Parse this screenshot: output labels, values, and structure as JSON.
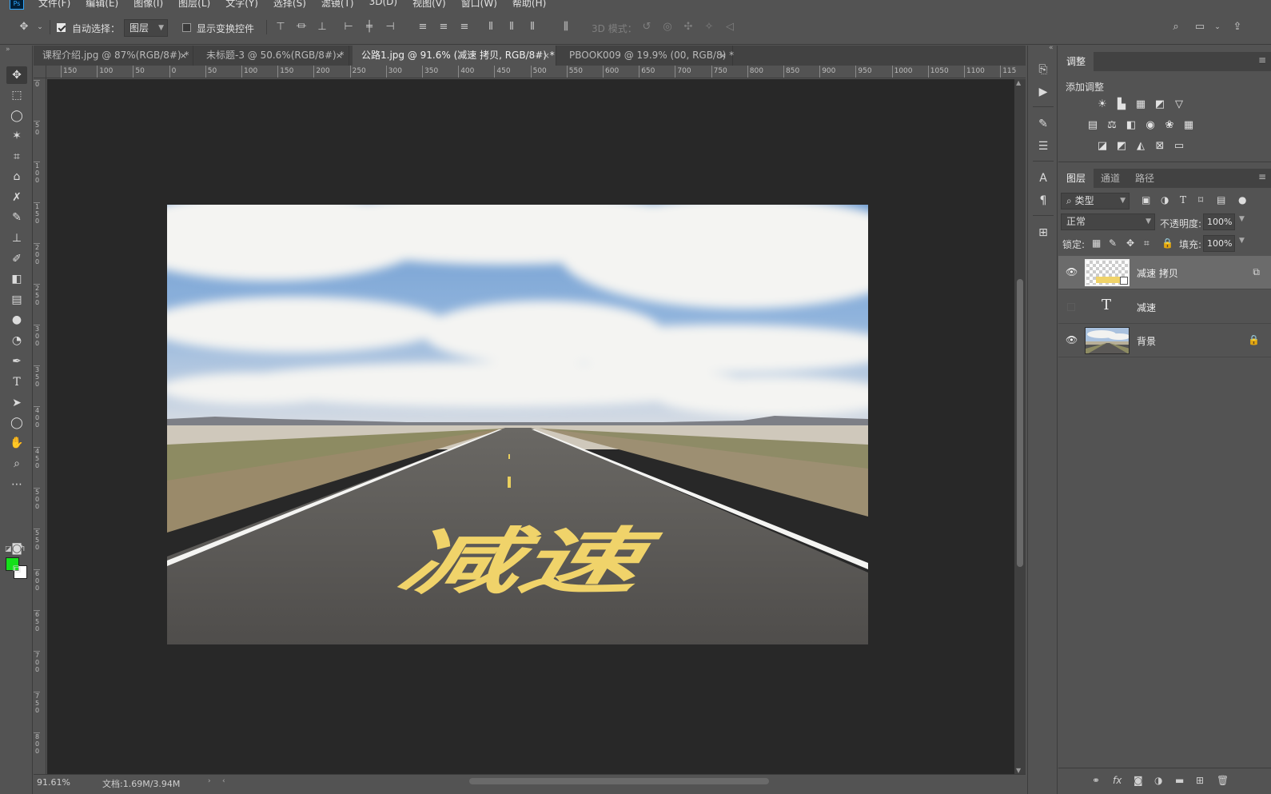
{
  "menubar": {
    "logo": "Ps",
    "items": [
      "文件(F)",
      "编辑(E)",
      "图像(I)",
      "图层(L)",
      "文字(Y)",
      "选择(S)",
      "滤镜(T)",
      "3D(D)",
      "视图(V)",
      "窗口(W)",
      "帮助(H)"
    ]
  },
  "options": {
    "auto_select_label": "自动选择：",
    "auto_select_checked": true,
    "auto_select_target": "图层",
    "show_transform_label": "显示变换控件",
    "show_transform_checked": false,
    "mode_3d_label": "3D 模式："
  },
  "tabs": [
    {
      "label": "课程介绍.jpg @ 87%(RGB/8#) *",
      "active": false
    },
    {
      "label": "未标题-3 @ 50.6%(RGB/8#) *",
      "active": false
    },
    {
      "label": "公路1.jpg @ 91.6% (减速 拷贝, RGB/8#) *",
      "active": true
    },
    {
      "label": "PBOOK009 @ 19.9% (00, RGB/8) *",
      "active": false
    }
  ],
  "ruler": {
    "h_labels": [
      "150",
      "100",
      "50",
      "0",
      "50",
      "100",
      "150",
      "200",
      "250",
      "300",
      "350",
      "400",
      "450",
      "500",
      "550",
      "600",
      "650",
      "700",
      "750",
      "800",
      "850",
      "900",
      "950",
      "1000",
      "1050",
      "1100",
      "115"
    ],
    "v_labels": [
      "0",
      "50",
      "100",
      "150",
      "200",
      "250",
      "300",
      "350",
      "400",
      "450",
      "500",
      "550",
      "600",
      "650",
      "700",
      "750",
      "800"
    ]
  },
  "canvas": {
    "road_text": "减速",
    "colors": {
      "sky_top": "#5d8fc8",
      "cloud": "#f2f2f0",
      "road": "#5a5856",
      "text_yellow": "#f0d36a",
      "grass": "#8d8b62"
    }
  },
  "statusbar": {
    "zoom": "91.61%",
    "doc_info": "文档:1.69M/3.94M"
  },
  "colors": {
    "foreground": "#15e01a",
    "background": "#ffffff"
  },
  "adjust_panel": {
    "tab_label": "调整",
    "add_label": "添加调整"
  },
  "layers_panel": {
    "tabs": [
      "图层",
      "通道",
      "路径"
    ],
    "filter_label": "类型",
    "blend_mode": "正常",
    "opacity_label": "不透明度:",
    "opacity_value": "100%",
    "lock_label": "锁定:",
    "fill_label": "填充:",
    "fill_value": "100%",
    "layers": [
      {
        "name": "减速 拷贝",
        "visible": true,
        "selected": true,
        "kind": "smart"
      },
      {
        "name": "减速",
        "visible": false,
        "selected": false,
        "kind": "text"
      },
      {
        "name": "背景",
        "visible": true,
        "selected": false,
        "kind": "image",
        "locked": true
      }
    ]
  }
}
